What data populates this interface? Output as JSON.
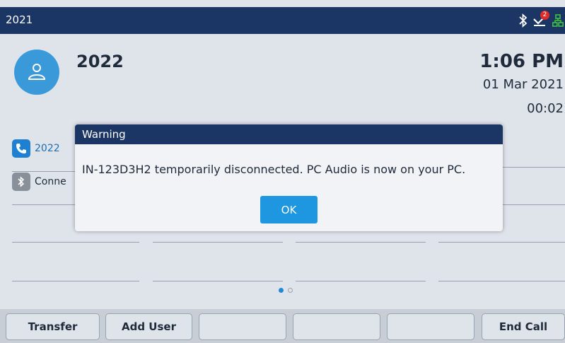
{
  "status_bar": {
    "title": "2021",
    "icons": [
      "bluetooth-icon",
      "voicemail-icon",
      "network-icon"
    ],
    "voicemail_count": "2"
  },
  "call": {
    "name": "2022",
    "time": "1:06 PM",
    "date": "01 Mar 2021",
    "duration": "00:02"
  },
  "lines": [
    {
      "label": "2022",
      "icon": "phone-icon"
    },
    {
      "label": "Conne",
      "icon": "bluetooth-icon"
    }
  ],
  "pager": {
    "page": 1,
    "total": 2
  },
  "softkeys": [
    "Transfer",
    "Add User",
    "",
    "",
    "",
    "End Call"
  ],
  "dialog": {
    "title": "Warning",
    "message": "IN-123D3H2 temporarily disconnected. PC Audio is now on your PC.",
    "ok_label": "OK"
  },
  "colors": {
    "header": "#1b3664",
    "accent": "#1e97e0",
    "background": "#dfe3ea"
  }
}
